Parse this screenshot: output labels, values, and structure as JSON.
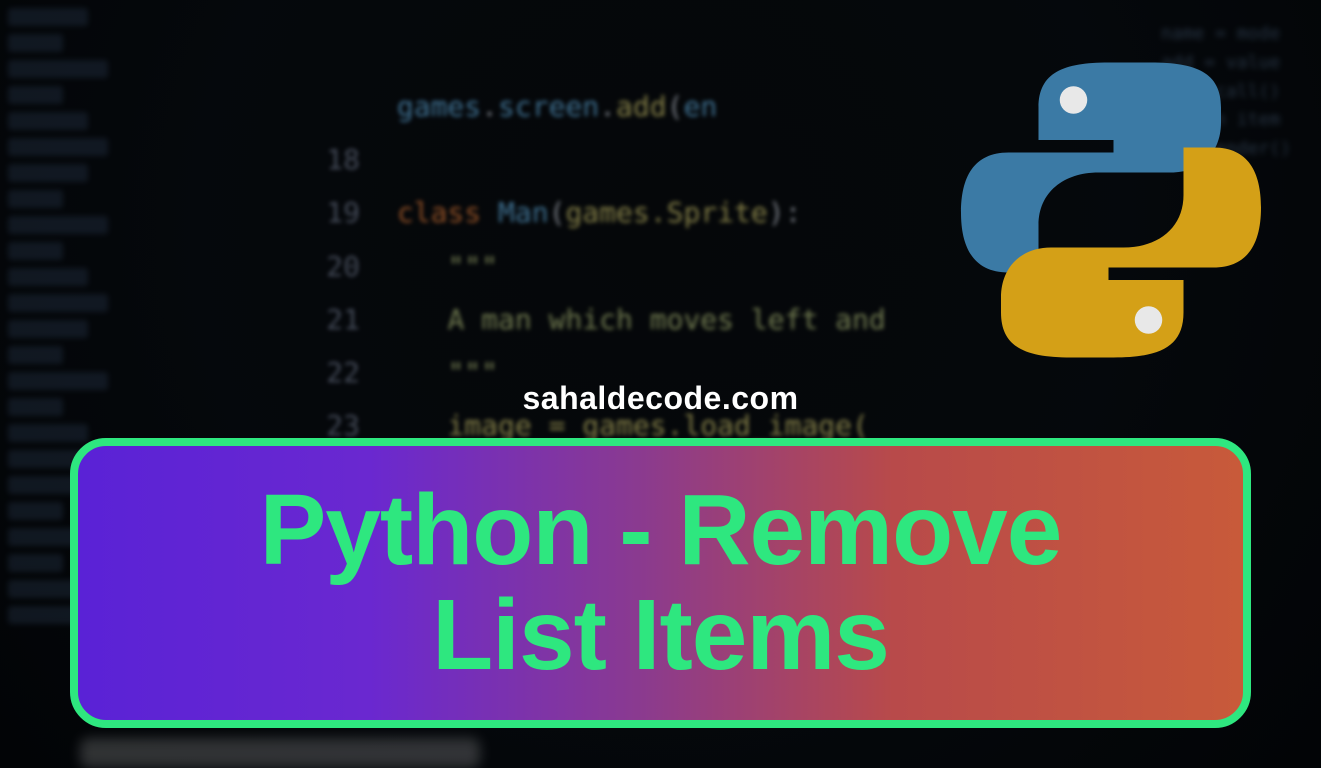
{
  "watermark_text": "sahaldecode.com",
  "banner": {
    "line1": "Python - Remove",
    "line2": "List Items"
  },
  "code_lines": [
    {
      "num": "",
      "frag1": "games",
      "frag2": ".",
      "frag3": "screen",
      "frag4": ".",
      "frag5": "add",
      "frag6": "(",
      "frag7": "en"
    },
    {
      "num": "18",
      "text": ""
    },
    {
      "num": "19",
      "kw": "class",
      "cls": " Man",
      "pun": "(",
      "arg": "games.Sprite",
      "pun2": "):"
    },
    {
      "num": "20",
      "str": "\"\"\""
    },
    {
      "num": "21",
      "cm": "A man which moves left and"
    },
    {
      "num": "22",
      "str": "\"\"\""
    },
    {
      "num": "23",
      "text": "image = games.load_image("
    }
  ],
  "logo_name": "python-logo"
}
